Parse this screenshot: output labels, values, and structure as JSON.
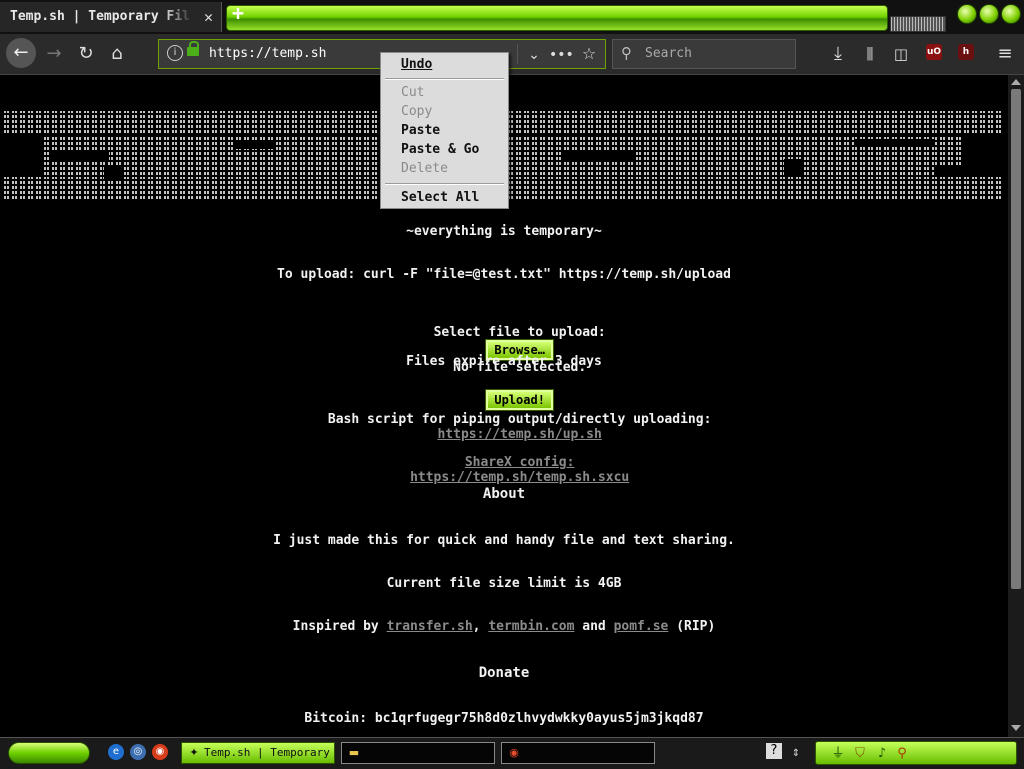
{
  "browser": {
    "tab_title": "Temp.sh | Temporary File Sharing",
    "new_tab_symbol": "+",
    "close_tab_symbol": "✕",
    "url": "https://temp.sh",
    "search_placeholder": "Search",
    "icons": [
      "back-icon",
      "forward-icon",
      "reload-icon",
      "home-icon",
      "info-icon",
      "lock-icon",
      "dropdown-icon",
      "page-actions-icon",
      "bookmark-star-icon",
      "search-icon",
      "download-icon",
      "library-icon",
      "sidebar-icon",
      "ublock-icon",
      "extension-icon",
      "menu-icon"
    ],
    "accent_color": "#6fd000"
  },
  "context_menu": {
    "undo": "Undo",
    "cut": "Cut",
    "copy": "Copy",
    "paste": "Paste",
    "paste_go": "Paste & Go",
    "delete": "Delete",
    "select_all": "Select All"
  },
  "page": {
    "tagline": "~everything is temporary~",
    "upload_cmd": "To upload: curl -F \"file=@test.txt\" https://temp.sh/upload",
    "select_label": "Select file to upload:",
    "browse_label": "Browse…",
    "no_file": "No file selected.",
    "upload_btn": "Upload!",
    "expire": "Files expire after 3 days",
    "bash_label": "Bash script for piping output/directly uploading:",
    "bash_link": "https://temp.sh/up.sh",
    "sharex_label": "ShareX config:",
    "sharex_link": "https://temp.sh/temp.sh.sxcu",
    "about_heading": "About",
    "about_text": "I just made this for quick and handy file and text sharing.",
    "size_limit": "Current file size limit is 4GB",
    "inspired_prefix": "Inspired by",
    "inspired_link1": "transfer.sh",
    "inspired_sep": ",",
    "inspired_link2": "termbin.com",
    "inspired_and": "and",
    "inspired_link3": "pomf.se",
    "inspired_suffix": "(RIP)",
    "donate_heading": "Donate",
    "bitcoin": "Bitcoin: bc1qrfugegr75h8d0zlhvydwkky0ayus5jm3jkqd87"
  },
  "taskbar": {
    "tasks": [
      "Temp.sh | Temporary File Sharing",
      "",
      ""
    ],
    "start_color": "#6ecf00"
  }
}
